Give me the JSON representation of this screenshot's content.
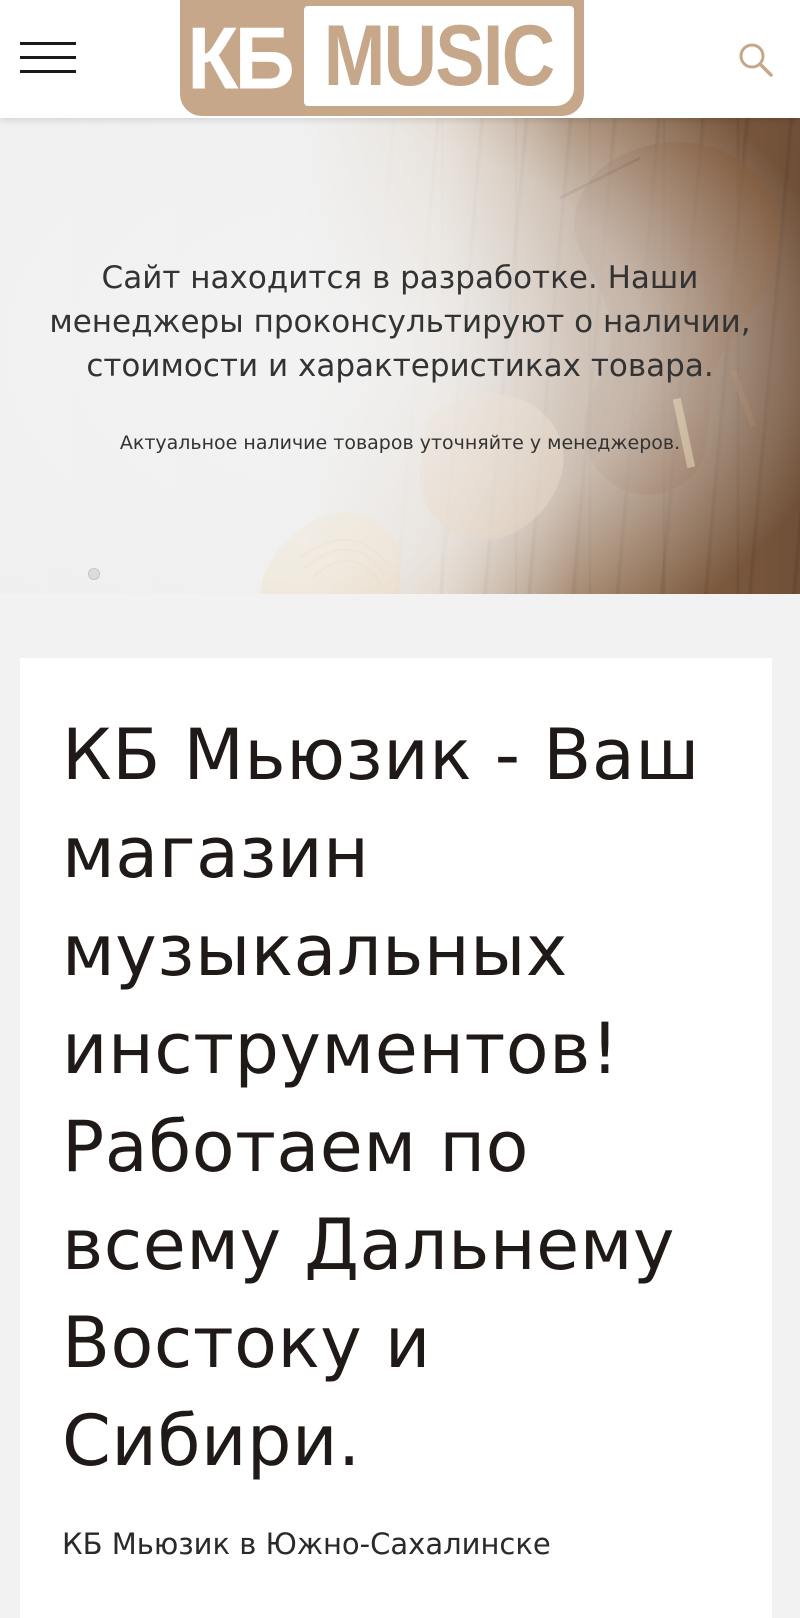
{
  "header": {
    "menu_icon": "hamburger-menu-icon",
    "logo": {
      "part1": "КБ",
      "part2": "MUSIC"
    },
    "search_icon": "search-icon",
    "colors": {
      "accent": "#c7a78a"
    }
  },
  "hero": {
    "title": "Сайт находится в разработке. Наши менеджеры проконсультируют о наличии, стоимости и характеристиках товара.",
    "subtitle": "Актуальное наличие товаров уточняйте у менеджеров."
  },
  "main": {
    "heading": "КБ Мьюзик - Ваш магазин музыкальных инструментов! Работаем по всему Дальнему Востоку и Сибири.",
    "intro_text": "КБ Мьюзик в Южно-Сахалинске"
  }
}
